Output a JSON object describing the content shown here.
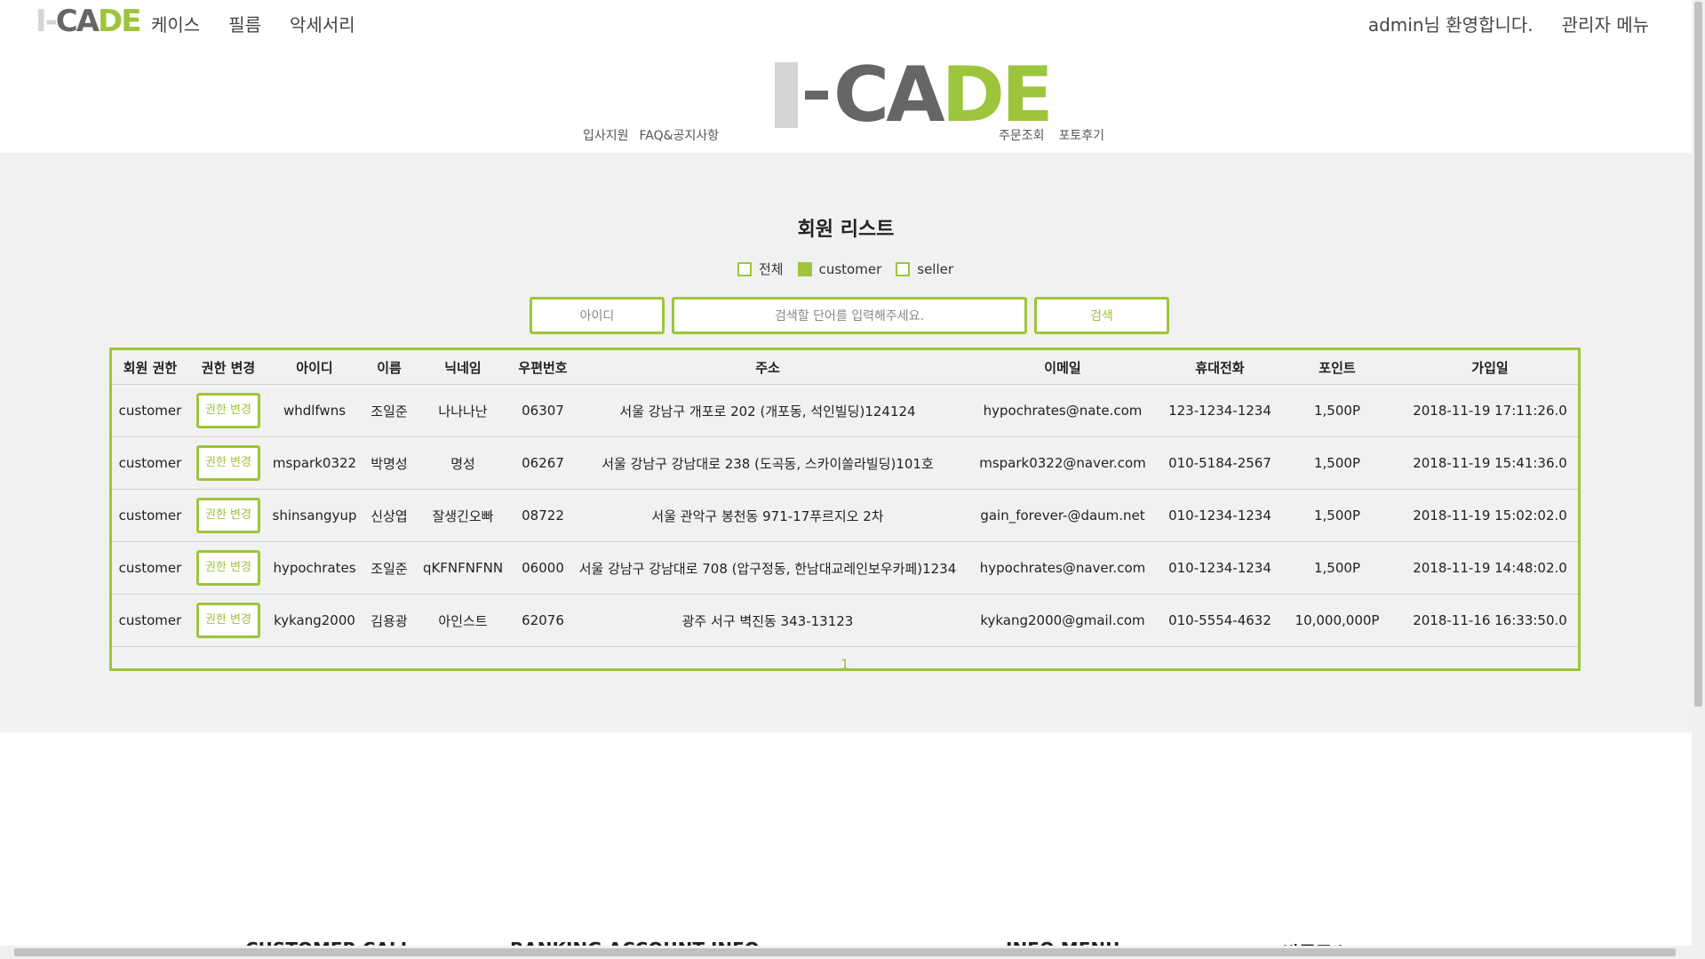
{
  "header": {
    "logo_small": {
      "i": "I-",
      "ca": "CA",
      "de": "DE"
    },
    "nav": [
      "케이스",
      "필름",
      "악세서리"
    ],
    "welcome": "admin님 환영합니다.",
    "admin_menu": "관리자 메뉴",
    "big_logo": {
      "ca": "CA",
      "de": "DE"
    },
    "sub_left": [
      "입사지원",
      "FAQ&공지사항"
    ],
    "sub_right": [
      "주문조회",
      "포토후기"
    ]
  },
  "main": {
    "title": "회원 리스트",
    "filters": [
      {
        "label": "전체",
        "checked": false
      },
      {
        "label": "customer",
        "checked": true
      },
      {
        "label": "seller",
        "checked": false
      }
    ],
    "search": {
      "select_value": "아이디",
      "placeholder": "검색할 단어를 입력해주세요.",
      "button": "검색"
    },
    "table": {
      "headers": [
        "회원 권한",
        "권한 변경",
        "아이디",
        "이름",
        "닉네임",
        "우편번호",
        "주소",
        "이메일",
        "휴대전화",
        "포인트",
        "가입일"
      ],
      "perm_button": "권한 변경",
      "rows": [
        [
          "customer",
          "whdlfwns",
          "조일준",
          "나나나난",
          "06307",
          "서울 강남구 개포로 202 (개포동, 석인빌딩)124124",
          "hypochrates@nate.com",
          "123-1234-1234",
          "1,500P",
          "2018-11-19 17:11:26.0"
        ],
        [
          "customer",
          "mspark0322",
          "박명성",
          "명성",
          "06267",
          "서울 강남구 강남대로 238 (도곡동, 스카이쏠라빌딩)101호",
          "mspark0322@naver.com",
          "010-5184-2567",
          "1,500P",
          "2018-11-19 15:41:36.0"
        ],
        [
          "customer",
          "shinsangyup",
          "신상엽",
          "잘생긴오빠",
          "08722",
          "서울 관악구 봉천동 971-17푸르지오 2차",
          "gain_forever-@daum.net",
          "010-1234-1234",
          "1,500P",
          "2018-11-19 15:02:02.0"
        ],
        [
          "customer",
          "hypochrates",
          "조일준",
          "qKFNFNFNN",
          "06000",
          "서울 강남구 강남대로 708 (압구정동, 한남대교레인보우카페)1234",
          "hypochrates@naver.com",
          "010-1234-1234",
          "1,500P",
          "2018-11-19 14:48:02.0"
        ],
        [
          "customer",
          "kykang2000",
          "김용광",
          "아인스트",
          "62076",
          "광주 서구 벽진동 343-13123",
          "kykang2000@gmail.com",
          "010-5554-4632",
          "10,000,000P",
          "2018-11-16 16:33:50.0"
        ]
      ],
      "pagination": [
        "1"
      ]
    }
  },
  "footer": {
    "peek": [
      "CUSTOMER CALL",
      "BANKING ACCOUNT INFO",
      "INFO MENU",
      "반품주소"
    ]
  },
  "colors": {
    "accent": "#9dc53b",
    "logo_gray": "#666666",
    "logo_light": "#d4d4d4"
  }
}
